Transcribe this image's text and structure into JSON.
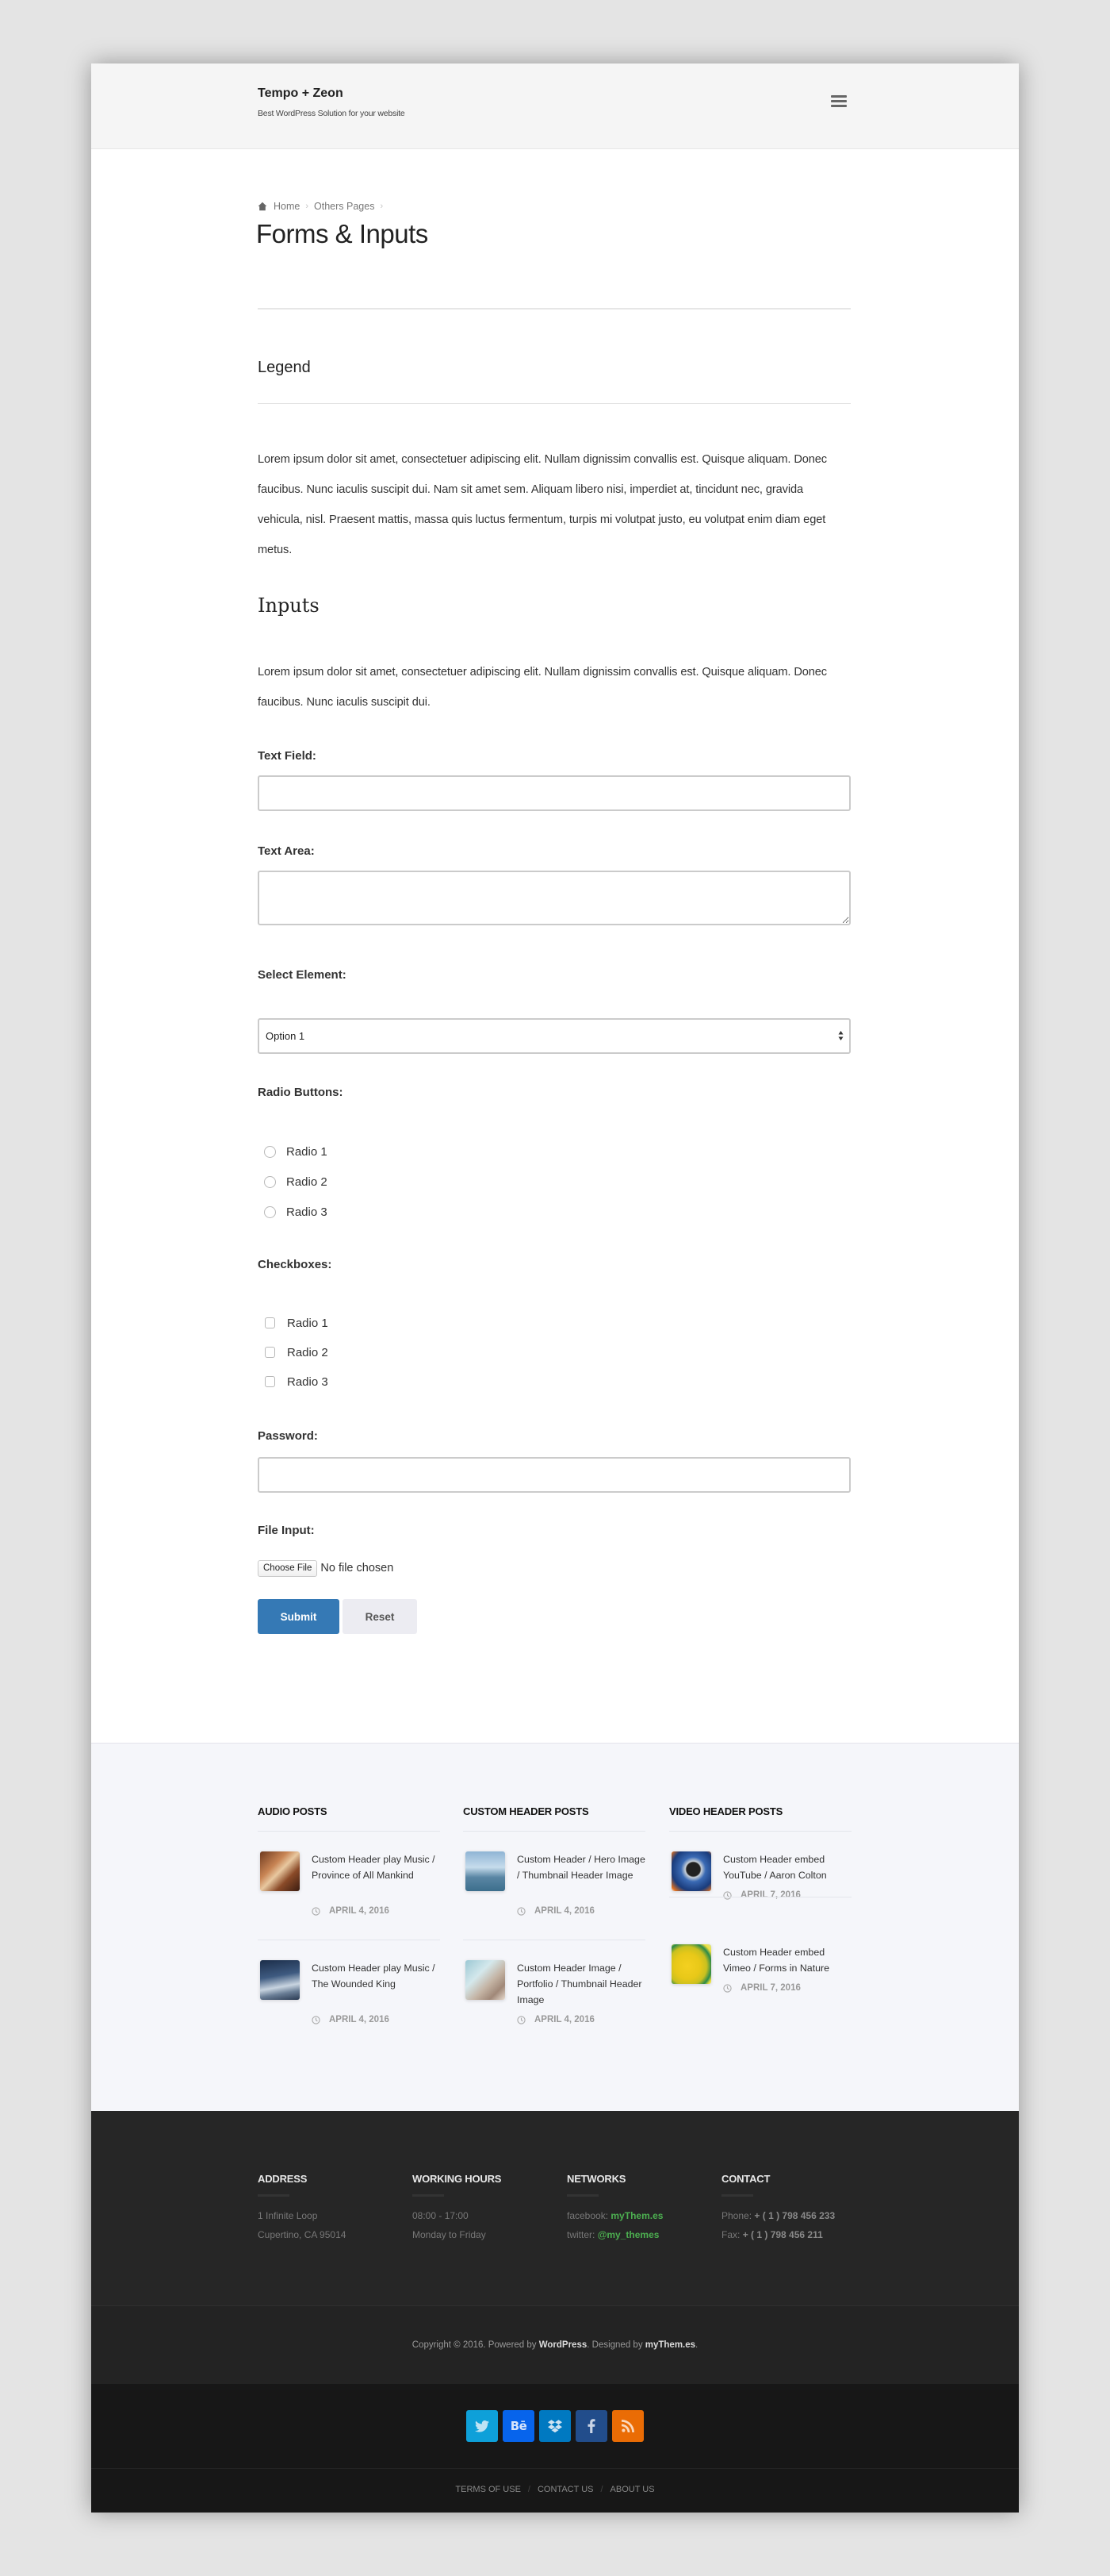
{
  "header": {
    "site_title": "Tempo + Zeon",
    "tagline": "Best WordPress Solution for your website",
    "menu_icon": "hamburger-menu-icon"
  },
  "breadcrumb": {
    "icon": "home-icon",
    "items": [
      "Home",
      "Others Pages"
    ],
    "separator": "›"
  },
  "page": {
    "title": "Forms & Inputs",
    "legend": "Legend",
    "intro_paragraph": "Lorem ipsum dolor sit amet, consectetuer adipiscing elit. Nullam dignissim convallis est. Quisque aliquam. Donec faucibus. Nunc iaculis suscipit dui. Nam sit amet sem. Aliquam libero nisi, imperdiet at, tincidunt nec, gravida vehicula, nisl. Praesent mattis, massa quis luctus fermentum, turpis mi volutpat justo, eu volutpat enim diam eget metus.",
    "inputs_heading": "Inputs",
    "inputs_paragraph": "Lorem ipsum dolor sit amet, consectetuer adipiscing elit. Nullam dignissim convallis est. Quisque aliquam. Donec faucibus. Nunc iaculis suscipit dui."
  },
  "form": {
    "text_field": {
      "label": "Text Field:",
      "value": "",
      "placeholder": ""
    },
    "text_area": {
      "label": "Text Area:",
      "value": "",
      "placeholder": ""
    },
    "select": {
      "label": "Select Element:",
      "selected": "Option 1"
    },
    "radios": {
      "label": "Radio Buttons:",
      "options": [
        "Radio 1",
        "Radio 2",
        "Radio 3"
      ],
      "checked": null
    },
    "checkboxes": {
      "label": "Checkboxes:",
      "options": [
        "Radio 1",
        "Radio 2",
        "Radio 3"
      ],
      "checked": []
    },
    "password": {
      "label": "Password:",
      "value": ""
    },
    "file_input": {
      "label": "File Input:",
      "button_label": "Choose File",
      "status": "No file chosen"
    },
    "submit_label": "Submit",
    "reset_label": "Reset"
  },
  "widgets": [
    {
      "title": "AUDIO POSTS",
      "items": [
        {
          "title": "Custom Header play Music / Province of All Mankind",
          "date": "APRIL 4, 2016",
          "thumb": "thumbnail-musician"
        },
        {
          "title": "Custom Header play Music / The Wounded King",
          "date": "APRIL 4, 2016",
          "thumb": "thumbnail-mountains"
        }
      ]
    },
    {
      "title": "CUSTOM HEADER POSTS",
      "items": [
        {
          "title": "Custom Header / Hero Image / Thumbnail Header Image",
          "date": "APRIL 4, 2016",
          "thumb": "thumbnail-pier"
        },
        {
          "title": "Custom Header Image / Portfolio / Thumbnail Header Image",
          "date": "APRIL 4, 2016",
          "thumb": "thumbnail-coast"
        }
      ]
    },
    {
      "title": "VIDEO HEADER POSTS",
      "items": [
        {
          "title": "Custom Header embed YouTube / Aaron Colton",
          "date": "APRIL 7, 2016",
          "thumb": "thumbnail-skier"
        },
        {
          "title": "Custom Header embed Vimeo / Forms in Nature",
          "date": "APRIL 7, 2016",
          "thumb": "thumbnail-yellow-pattern"
        }
      ]
    }
  ],
  "footer": {
    "address": {
      "heading": "ADDRESS",
      "line1": "1 Infinite Loop",
      "line2": "Cupertino, CA 95014"
    },
    "hours": {
      "heading": "WORKING HOURS",
      "line1": "08:00 - 17:00",
      "line2": "Monday to Friday"
    },
    "networks": {
      "heading": "NETWORKS",
      "facebook_label": "facebook:",
      "facebook_value": "myThem.es",
      "twitter_label": "twitter:",
      "twitter_value": "@my_themes"
    },
    "contact": {
      "heading": "CONTACT",
      "phone_label": "Phone:",
      "phone_value": "+ ( 1 ) 798 456 233",
      "fax_label": "Fax:",
      "fax_value": "+ ( 1 ) 798 456 211"
    },
    "copyright": {
      "prefix": "Copyright © 2016. Powered by ",
      "powered_by": "WordPress",
      "middle": ". Designed by ",
      "designer": "myThem.es",
      "suffix": "."
    },
    "socials": [
      {
        "name": "twitter",
        "icon": "twitter-icon",
        "color": "#0ea0d9"
      },
      {
        "name": "behance",
        "icon": "behance-icon",
        "color": "#0764ec"
      },
      {
        "name": "dropbox",
        "icon": "dropbox-icon",
        "color": "#0079c1"
      },
      {
        "name": "facebook",
        "icon": "facebook-icon",
        "color": "#224d8b"
      },
      {
        "name": "rss",
        "icon": "rss-icon",
        "color": "#ea6c05"
      }
    ],
    "links": [
      "TERMS OF USE",
      "CONTACT US",
      "ABOUT US"
    ]
  },
  "colors": {
    "accent": "#3579b5",
    "link_green": "#4caf50"
  }
}
